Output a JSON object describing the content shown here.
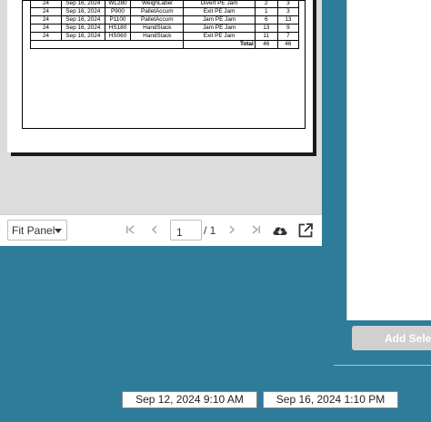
{
  "report": {
    "rows": [
      {
        "id": "24",
        "date": "Sep 16, 2024",
        "device": "WL280",
        "area": "WeighLabel",
        "fault": "Divert PE Jam",
        "n1": "2",
        "n2": "3"
      },
      {
        "id": "24",
        "date": "Sep 16, 2024",
        "device": "P900",
        "area": "PalletAccum",
        "fault": "Exit PE Jam",
        "n1": "1",
        "n2": "3"
      },
      {
        "id": "24",
        "date": "Sep 16, 2024",
        "device": "P1100",
        "area": "PalletAccum",
        "fault": "Jam PE Jam",
        "n1": "6",
        "n2": "13"
      },
      {
        "id": "24",
        "date": "Sep 16, 2024",
        "device": "HS180",
        "area": "HandStack",
        "fault": "Jam PE Jam",
        "n1": "13",
        "n2": "9"
      },
      {
        "id": "24",
        "date": "Sep 16, 2024",
        "device": "HS060",
        "area": "HandStack",
        "fault": "Exit PE Jam",
        "n1": "11",
        "n2": "7"
      }
    ],
    "total_label": "Total",
    "total_n1": "46",
    "total_n2": "46"
  },
  "toolbar": {
    "fit_label": "Fit Panel",
    "first_icon": "first-page-icon",
    "prev_icon": "prev-page-icon",
    "next_icon": "next-page-icon",
    "last_icon": "last-page-icon",
    "page_value": "1",
    "page_of": "/ 1",
    "download_icon": "cloud-download-icon",
    "open_icon": "open-external-icon"
  },
  "side_panel": {
    "add_selected_label": "Add Selected"
  },
  "date_range": {
    "start": "Sep 12, 2024 9:10 AM",
    "end": "Sep 16, 2024 1:10 PM"
  },
  "colors": {
    "background": "#2d7c9a",
    "viewer": "#dcdcdc",
    "disabled_button": "#d0d0d0"
  }
}
